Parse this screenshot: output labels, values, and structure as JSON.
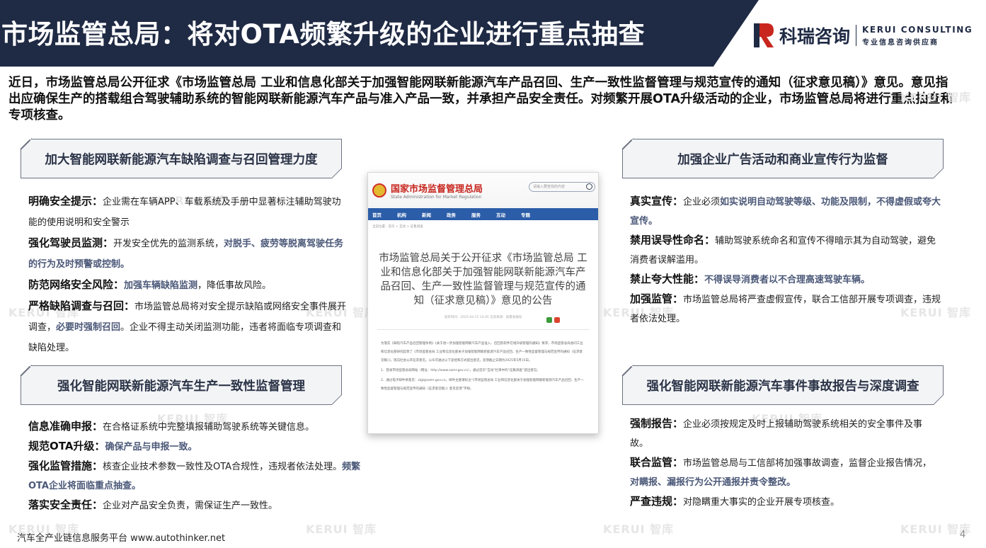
{
  "header": {
    "title": "市场监管总局：将对OTA频繁升级的企业进行重点抽查",
    "brand_cn": "科瑞咨询",
    "brand_en": "KERUI CONSULTING",
    "brand_sub": "专业信息咨询供应商",
    "colors": {
      "bar": "#1f2a44",
      "brand_red": "#c8261e"
    }
  },
  "intro": "近日，市场监管总局公开征求《市场监管总局 工业和信息化部关于加强智能网联新能源汽车产品召回、生产一致性监督管理与规范宣传的通知（征求意见稿）》意见。意见指出应确保生产的搭载组合驾驶辅助系统的智能网联新能源汽车产品与准入产品一致，并承担产品安全责任。对频繁开展OTA升级活动的企业，市场监管总局将进行重点抽查和专项核查。",
  "sections": {
    "recall": {
      "title": "加大智能网联新能源汽车缺陷调查与召回管理力度",
      "items": [
        {
          "label": "明确安全提示：",
          "text": "企业需在车辆APP、车载系统及手册中显著标注辅助驾驶功能的使用说明和安全警示"
        },
        {
          "label": "强化驾驶员监测：",
          "text": "开发安全优先的监测系统，",
          "highlight": "对脱手、疲劳等脱离驾驶任务的行为及时预警或控制。"
        },
        {
          "label": "防范网络安全风险：",
          "highlight": "加强车辆缺陷监测",
          "text": "，降低事故风险。"
        },
        {
          "label": "严格缺陷调查与召回：",
          "text": "市场监管总局将对安全提示缺陷或网络安全事件展开调查，",
          "highlight": "必要时强制召回",
          "text2": "。企业不得主动关闭监测功能，违者将面临专项调查和缺陷处理。"
        }
      ]
    },
    "consistency": {
      "title": "强化智能网联新能源汽车生产一致性监督管理",
      "items": [
        {
          "label": "信息准确申报：",
          "text": "在合格证系统中完整填报辅助驾驶系统等关键信息。"
        },
        {
          "label": "规范OTA升级：",
          "highlight": "确保产品与申报一致。"
        },
        {
          "label": "强化监管措施：",
          "text": "核查企业技术参数一致性及OTA合规性，违规者依法处理。",
          "highlight": "频繁OTA企业将面临重点抽查。"
        },
        {
          "label": "落实安全责任：",
          "text": "企业对产品安全负责，需保证生产一致性。"
        }
      ]
    },
    "advertising": {
      "title": "加强企业广告活动和商业宣传行为监督",
      "items": [
        {
          "label": "真实宣传：",
          "text": "企业必须",
          "highlight": "如实说明自动驾驶等级、功能及限制，不得虚假或夸大宣传。"
        },
        {
          "label": "禁用误导性命名：",
          "text": "辅助驾驶系统命名和宣传不得暗示其为自动驾驶，避免消费者误解滥用。"
        },
        {
          "label": "禁止夸大性能：",
          "highlight": "不得误导消费者以不合理高速驾驶车辆。"
        },
        {
          "label": "加强监管：",
          "text": "市场监管总局将严查虚假宣传，联合工信部开展专项调查，违规者依法处理。"
        }
      ]
    },
    "accident": {
      "title": "强化智能网联新能源汽车事件事故报告与深度调查",
      "items": [
        {
          "label": "强制报告：",
          "text": "企业必须按规定及时上报辅助驾驶系统相关的安全事件及事故。"
        },
        {
          "label": "联合监管：",
          "text": "市场监管总局与工信部将加强事故调查，监督企业报告情况，",
          "highlight": "对瞒报、漏报行为公开通报并责令整改。"
        },
        {
          "label": "严查违规：",
          "text": "对隐瞒重大事实的企业开展专项核查。"
        }
      ]
    }
  },
  "document": {
    "org_cn": "国家市场监督管理总局",
    "org_en": "State Administration for Market Regulation",
    "search_placeholder": "请输入要查找的内容",
    "nav": [
      "首页",
      "机构",
      "新闻",
      "政务",
      "服务",
      "互动",
      "专题"
    ],
    "breadcrumb": "当前位置：首页 > 互动 > 征集调查",
    "title": "市场监管总局关于公开征求《市场监管总局 工业和信息化部关于加强智能网联新能源汽车产品召回、生产一致性监督管理与规范宣传的通知（征求意见稿）》意见的公告",
    "meta": "发布时间：2025-04-15 10:45    信息来源：质量发展局",
    "body": [
      "为落实《缺陷汽车产品召回管理条例》《关于进一步加强智能网联汽车产品准入、召回及软件在线升级管理的通知》要求，市场监管总局会同工业和信息化部研究起草了《市场监管总局 工业和信息化部关于加强智能网联新能源汽车产品召回、生产一致性监督管理与规范宣传的通知（征求意见稿）》，现向社会公开征求意见。公众可通过以下途径和方式提出意见，反馈截止日期为2025年5月15日。",
      "1．登录市场监管总局网站（网址：http://www.samr.gov.cn），通过首页“互动”栏目中的“征集调查”提出意见。",
      "2．通过电子邮件将意见：zlgl@samr.gov.cn。邮件主题请标注“《市场监管总局 工业和信息化部关于加强智能网联新能源汽车产品召回、生产一致性监督管理与规范宣传的通知（征求意见稿）》意见反馈”字样。"
    ]
  },
  "watermark": "KERUI 智库",
  "footer": {
    "text": "汽车全产业链信息服务平台 www.autothinker.net",
    "page_number": "4"
  }
}
